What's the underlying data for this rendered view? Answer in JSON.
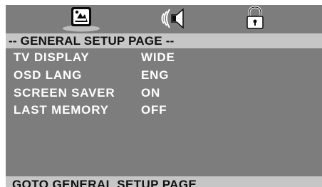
{
  "tabs": [
    {
      "icon": "monitor-setup-icon"
    },
    {
      "icon": "speaker-audio-icon"
    },
    {
      "icon": "padlock-icon"
    }
  ],
  "page_title": "-- GENERAL SETUP PAGE --",
  "settings": [
    {
      "label": "TV DISPLAY",
      "value": "WIDE"
    },
    {
      "label": "OSD LANG",
      "value": "ENG"
    },
    {
      "label": "SCREEN SAVER",
      "value": "ON"
    },
    {
      "label": "LAST MEMORY",
      "value": "OFF"
    }
  ],
  "status_text": "GOTO GENERAL SETUP PAGE",
  "colors": {
    "background": "#7d7d7d",
    "bar": "#c6c6c6",
    "text_light": "#ffffff",
    "text_dark": "#111111"
  }
}
